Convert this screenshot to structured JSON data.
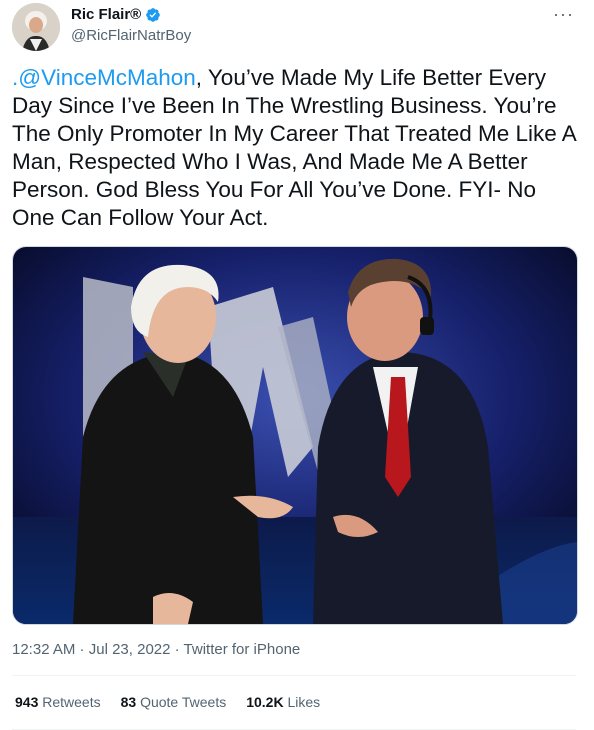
{
  "author": {
    "display_name": "Ric Flair®",
    "handle": "@RicFlairNatrBoy",
    "verified": true
  },
  "more_icon": "more-icon",
  "tweet": {
    "mention": ".@VinceMcMahon",
    "text_rest": ", You’ve Made My Life Better Every Day Since I’ve Been In The Wrestling Business. You’re The Only Promoter In My Career That Treated Me Like A Man, Respected Who I Was, And Made Me A Better Person. God Bless You For All You’ve Done. FYI- No One Can Follow Your Act."
  },
  "meta": {
    "time": "12:32 AM",
    "separator1": " · ",
    "date": "Jul 23, 2022",
    "separator2": " · ",
    "source": "Twitter for iPhone"
  },
  "stats": {
    "retweets_count": "943",
    "retweets_label": "Retweets",
    "quotes_count": "83",
    "quotes_label": "Quote Tweets",
    "likes_count": "10.2K",
    "likes_label": "Likes"
  },
  "colors": {
    "link": "#1d9bf0",
    "secondary": "#536471",
    "verified": "#1d9bf0"
  }
}
